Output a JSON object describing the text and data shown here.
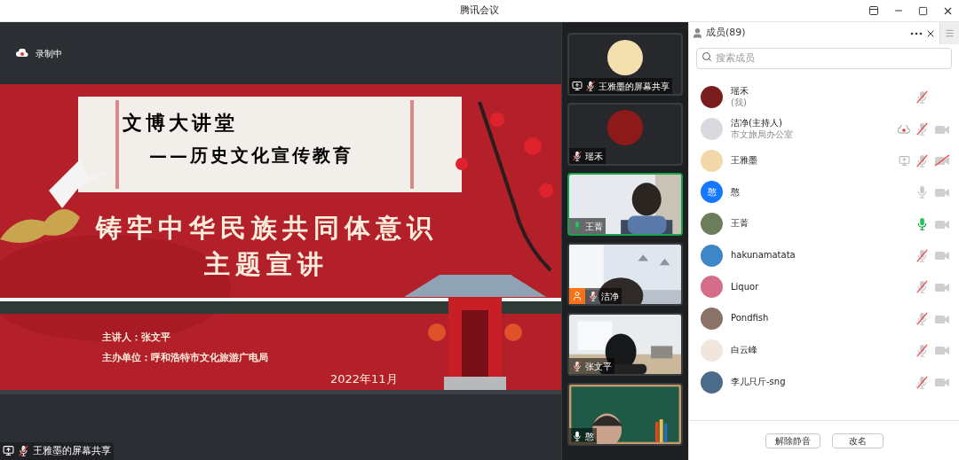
{
  "window": {
    "title": "腾讯会议"
  },
  "recording": {
    "label": "录制中"
  },
  "slide": {
    "heading": "文博大讲堂",
    "subheading": "——历史文化宣传教育",
    "title_lines": [
      "铸牢中华民族共同体意识",
      "主题宣讲"
    ],
    "details": [
      "主讲人：张文平",
      "主办单位：呼和浩特市文化旅游广电局"
    ],
    "date": "2022年11月"
  },
  "share_label": {
    "text": "王雅墨的屏幕共享",
    "mic_muted": true
  },
  "tiles": [
    {
      "kind": "avatar",
      "label": "王雅墨的屏幕共享",
      "mic_muted": true,
      "speaking": false,
      "screen_icon": true,
      "host_badge": false,
      "selected": false
    },
    {
      "kind": "avatar",
      "label": "瑶禾",
      "mic_muted": true,
      "speaking": false,
      "screen_icon": false,
      "host_badge": false,
      "selected": false
    },
    {
      "kind": "video",
      "label": "王菁",
      "mic_muted": false,
      "speaking": true,
      "screen_icon": false,
      "host_badge": false,
      "selected": true
    },
    {
      "kind": "video",
      "label": "洁净",
      "mic_muted": true,
      "speaking": false,
      "screen_icon": false,
      "host_badge": true,
      "selected": false
    },
    {
      "kind": "video",
      "label": "张文平",
      "mic_muted": true,
      "speaking": false,
      "screen_icon": false,
      "host_badge": false,
      "selected": false
    },
    {
      "kind": "video",
      "label": "憨",
      "mic_muted": false,
      "speaking": false,
      "screen_icon": false,
      "host_badge": false,
      "selected": false
    }
  ],
  "members_panel": {
    "title": "成员(89)",
    "search": {
      "placeholder": "搜索成员"
    },
    "members": [
      {
        "name": "瑶禾",
        "note": "(我)",
        "mic_muted": true,
        "speaking": false,
        "has_camera": false,
        "camera_muted": false,
        "recording": false,
        "sharing": false
      },
      {
        "name": "洁净(主持人)",
        "note": "市文旅局办公室",
        "mic_muted": true,
        "speaking": false,
        "has_camera": true,
        "camera_muted": false,
        "recording": true,
        "sharing": false
      },
      {
        "name": "王雅墨",
        "mic_muted": true,
        "speaking": false,
        "has_camera": true,
        "camera_muted": true,
        "recording": false,
        "sharing": true
      },
      {
        "name": "憨",
        "avatar_text": "憨",
        "mic_muted": false,
        "speaking": false,
        "has_camera": true,
        "camera_muted": false,
        "recording": false,
        "sharing": false
      },
      {
        "name": "王菁",
        "mic_muted": false,
        "speaking": true,
        "has_camera": true,
        "camera_muted": false,
        "recording": false,
        "sharing": false
      },
      {
        "name": "hakunamatata",
        "mic_muted": true,
        "speaking": false,
        "has_camera": true,
        "camera_muted": false,
        "recording": false,
        "sharing": false
      },
      {
        "name": "Liquor",
        "mic_muted": true,
        "speaking": false,
        "has_camera": true,
        "camera_muted": false,
        "recording": false,
        "sharing": false
      },
      {
        "name": "Pondfish",
        "mic_muted": true,
        "speaking": false,
        "has_camera": true,
        "camera_muted": false,
        "recording": false,
        "sharing": false
      },
      {
        "name": "白云峰",
        "mic_muted": true,
        "speaking": false,
        "has_camera": true,
        "camera_muted": false,
        "recording": false,
        "sharing": false
      },
      {
        "name": "李儿只斤-sng",
        "mic_muted": true,
        "speaking": false,
        "has_camera": true,
        "camera_muted": false,
        "recording": false,
        "sharing": false
      }
    ],
    "buttons": [
      "解除静音",
      "改名"
    ]
  }
}
